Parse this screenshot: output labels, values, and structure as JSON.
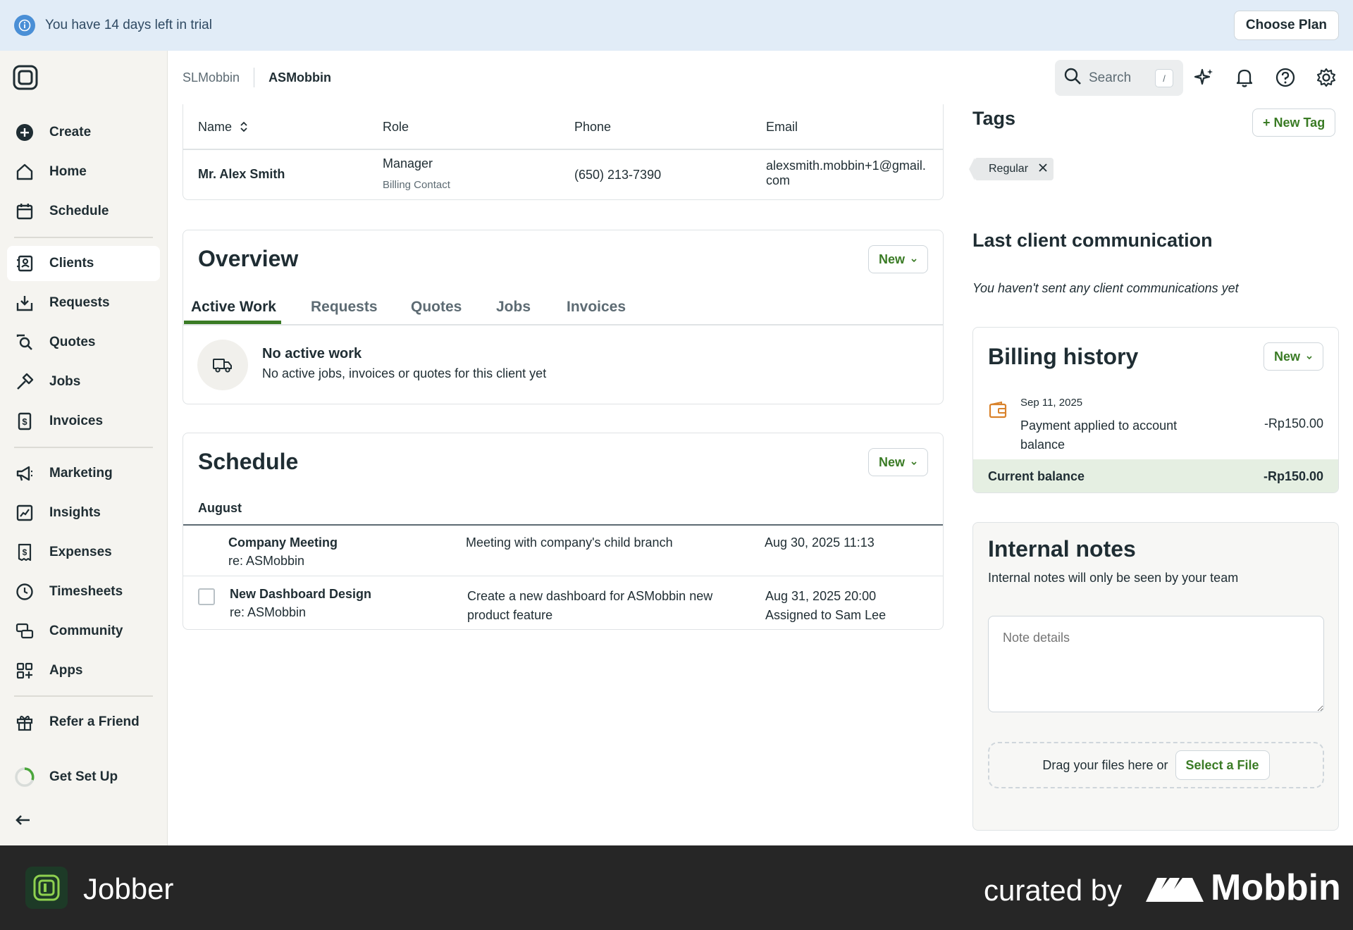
{
  "banner": {
    "text": "You have 14 days left in trial",
    "button": "Choose Plan"
  },
  "sidebar": {
    "items": [
      {
        "label": "Create",
        "icon": "plus-circle-icon"
      },
      {
        "label": "Home",
        "icon": "home-icon"
      },
      {
        "label": "Schedule",
        "icon": "calendar-icon"
      },
      {
        "label": "Clients",
        "icon": "clients-icon",
        "active": true
      },
      {
        "label": "Requests",
        "icon": "requests-icon"
      },
      {
        "label": "Quotes",
        "icon": "quotes-icon"
      },
      {
        "label": "Jobs",
        "icon": "hammer-icon"
      },
      {
        "label": "Invoices",
        "icon": "invoice-icon"
      },
      {
        "label": "Marketing",
        "icon": "megaphone-icon"
      },
      {
        "label": "Insights",
        "icon": "chart-icon"
      },
      {
        "label": "Expenses",
        "icon": "expenses-icon"
      },
      {
        "label": "Timesheets",
        "icon": "clock-icon"
      },
      {
        "label": "Community",
        "icon": "chat-icon"
      },
      {
        "label": "Apps",
        "icon": "apps-icon"
      },
      {
        "label": "Refer a Friend",
        "icon": "gift-icon"
      },
      {
        "label": "Get Set Up",
        "icon": "progress-ring-icon"
      }
    ]
  },
  "breadcrumb": {
    "first": "SLMobbin",
    "current": "ASMobbin"
  },
  "search": {
    "placeholder": "Search",
    "shortcut": "/"
  },
  "contacts": {
    "headers": [
      "Name",
      "Role",
      "Phone",
      "Email"
    ],
    "row": {
      "name": "Mr. Alex Smith",
      "role": "Manager",
      "role_sub": "Billing Contact",
      "phone": "(650) 213-7390",
      "email_line1": "alexsmith.mobbin+1@gmail.",
      "email_line2": "com"
    }
  },
  "overview": {
    "title": "Overview",
    "new_label": "New",
    "tabs": [
      "Active Work",
      "Requests",
      "Quotes",
      "Jobs",
      "Invoices"
    ],
    "empty_title": "No active work",
    "empty_text": "No active jobs, invoices or quotes for this client yet"
  },
  "schedule": {
    "title": "Schedule",
    "new_label": "New",
    "month": "August",
    "rows": [
      {
        "title": "Company Meeting",
        "sub": "re: ASMobbin",
        "desc": "Meeting with company's child branch",
        "desc2": "",
        "date": "Aug 30, 2025 11:13",
        "date2": ""
      },
      {
        "title": "New Dashboard Design",
        "sub": "re: ASMobbin",
        "desc": "Create a new dashboard for ASMobbin new",
        "desc2": "product feature",
        "date": "Aug 31, 2025 20:00",
        "date2": "Assigned to Sam Lee"
      }
    ]
  },
  "tags": {
    "title": "Tags",
    "new_tag": "+ New Tag",
    "items": [
      "Regular"
    ]
  },
  "communication": {
    "title": "Last client communication",
    "empty": "You haven't sent any client communications yet"
  },
  "billing": {
    "title": "Billing history",
    "new_label": "New",
    "entry_date": "Sep 11, 2025",
    "entry_line1": "Payment applied to account",
    "entry_line2": "balance",
    "entry_amount": "-Rp150.00",
    "balance_label": "Current balance",
    "balance_amount": "-Rp150.00"
  },
  "notes": {
    "title": "Internal notes",
    "subtitle": "Internal notes will only be seen by your team",
    "placeholder": "Note details",
    "drop_text": "Drag your files here or",
    "select_file": "Select a File"
  },
  "footer": {
    "brand": "Jobber",
    "curated": "curated by",
    "mobbin": "Mobbin"
  },
  "colors": {
    "accent_green": "#3a7b25",
    "banner_bg": "#e1ecf7",
    "footer_bg": "#262626"
  }
}
